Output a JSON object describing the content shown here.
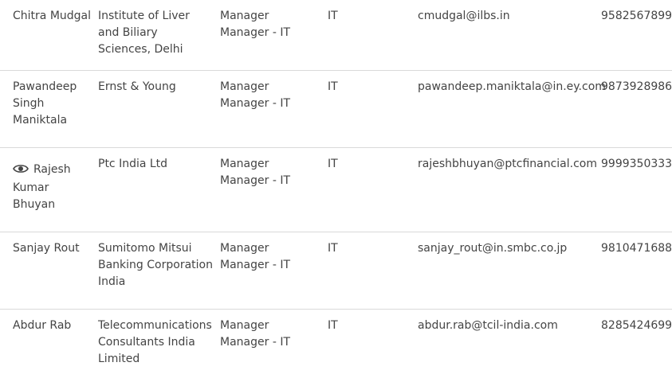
{
  "contacts": [
    {
      "name": "Chitra Mudgal",
      "organization": "Institute of Liver and Biliary Sciences, Delhi",
      "designation": "Manager",
      "role": "Manager - IT",
      "department": "IT",
      "email": "cmudgal@ilbs.in",
      "phone": "9582567899"
    },
    {
      "name": "Pawandeep Singh Maniktala",
      "organization": "Ernst & Young",
      "designation": "Manager",
      "role": "Manager - IT",
      "department": "IT",
      "email": "pawandeep.maniktala@in.ey.com",
      "phone": "9873928986"
    },
    {
      "name": "Rajesh Kumar Bhuyan",
      "organization": "Ptc India Ltd",
      "designation": "Manager",
      "role": "Manager - IT",
      "department": "IT",
      "email": "rajeshbhuyan@ptcfinancial.com",
      "phone": "9999350333",
      "icon": "eye-icon"
    },
    {
      "name": "Sanjay Rout",
      "organization": "Sumitomo Mitsui Banking Corporation India",
      "designation": "Manager",
      "role": "Manager - IT",
      "department": "IT",
      "email": "sanjay_rout@in.smbc.co.jp",
      "phone": "9810471688"
    },
    {
      "name": "Abdur Rab",
      "organization": "Telecommunications Consultants India Limited",
      "designation": "Manager",
      "role": "Manager - IT",
      "department": "IT",
      "email": "abdur.rab@tcil-india.com",
      "phone": "8285424699"
    }
  ],
  "colors": {
    "text": "#444444",
    "divider": "#d9d9d9"
  }
}
